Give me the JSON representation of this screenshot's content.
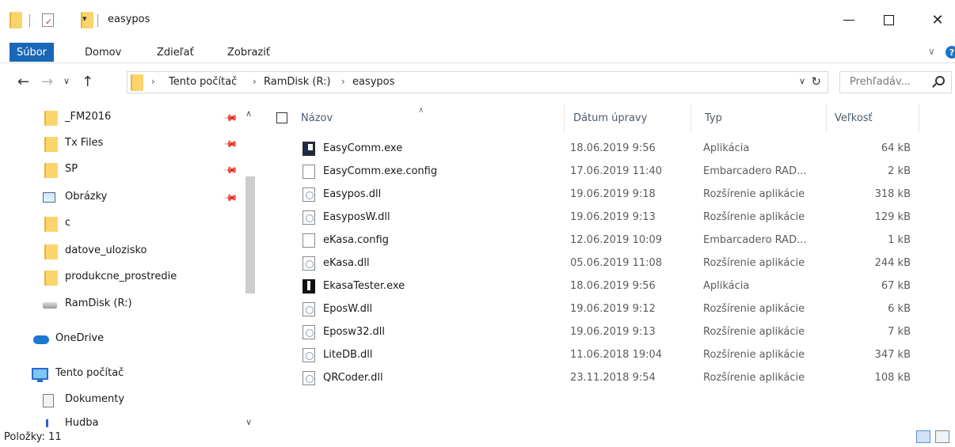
{
  "window": {
    "title": "easypos",
    "minimize_label": "—",
    "close_label": "✕"
  },
  "ribbon": {
    "tabs": [
      "Súbor",
      "Domov",
      "Zdieľať",
      "Zobraziť"
    ],
    "active_tab": "Súbor",
    "help_label": "?"
  },
  "address": {
    "breadcrumbs": [
      "Tento počítač",
      "RamDisk (R:)",
      "easypos"
    ]
  },
  "search": {
    "placeholder": "Prehľadáv..."
  },
  "nav": {
    "items": [
      {
        "label": "_FM2016",
        "icon": "folder-icon",
        "pinned": true
      },
      {
        "label": "Tx Files",
        "icon": "folder-icon",
        "pinned": true
      },
      {
        "label": "SP",
        "icon": "folder-icon",
        "pinned": true
      },
      {
        "label": "Obrázky",
        "icon": "pictures-icon",
        "pinned": true
      },
      {
        "label": "c",
        "icon": "folder-icon",
        "pinned": false
      },
      {
        "label": "datove_ulozisko",
        "icon": "folder-icon",
        "pinned": false
      },
      {
        "label": "produkcne_prostredie",
        "icon": "folder-icon",
        "pinned": false
      },
      {
        "label": "RamDisk (R:)",
        "icon": "drive-icon",
        "pinned": false
      },
      {
        "label": "OneDrive",
        "icon": "onedrive-icon",
        "pinned": false
      },
      {
        "label": "Tento počítač",
        "icon": "computer-icon",
        "pinned": false
      },
      {
        "label": "Dokumenty",
        "icon": "documents-icon",
        "pinned": false
      },
      {
        "label": "Hudba",
        "icon": "music-icon",
        "pinned": false
      }
    ]
  },
  "columns": {
    "name": "Názov",
    "date": "Dátum úpravy",
    "type": "Typ",
    "size": "Veľkosť"
  },
  "files": [
    {
      "name": "EasyComm.exe",
      "date": "18.06.2019 9:56",
      "type": "Aplikácia",
      "size": "64 kB",
      "icon": "exe-icon"
    },
    {
      "name": "EasyComm.exe.config",
      "date": "17.06.2019 11:40",
      "type": "Embarcadero RAD...",
      "size": "2 kB",
      "icon": "config-file-icon"
    },
    {
      "name": "Easypos.dll",
      "date": "19.06.2019 9:18",
      "type": "Rozšírenie aplikácie",
      "size": "318 kB",
      "icon": "dll-icon"
    },
    {
      "name": "EasyposW.dll",
      "date": "19.06.2019 9:13",
      "type": "Rozšírenie aplikácie",
      "size": "129 kB",
      "icon": "dll-icon"
    },
    {
      "name": "eKasa.config",
      "date": "12.06.2019 10:09",
      "type": "Embarcadero RAD...",
      "size": "1 kB",
      "icon": "config-file-icon"
    },
    {
      "name": "eKasa.dll",
      "date": "05.06.2019 11:08",
      "type": "Rozšírenie aplikácie",
      "size": "244 kB",
      "icon": "dll-icon"
    },
    {
      "name": "EkasaTester.exe",
      "date": "18.06.2019 9:56",
      "type": "Aplikácia",
      "size": "67 kB",
      "icon": "exe-icon"
    },
    {
      "name": "EposW.dll",
      "date": "19.06.2019 9:12",
      "type": "Rozšírenie aplikácie",
      "size": "6 kB",
      "icon": "dll-icon"
    },
    {
      "name": "Eposw32.dll",
      "date": "19.06.2019 9:13",
      "type": "Rozšírenie aplikácie",
      "size": "7 kB",
      "icon": "dll-icon"
    },
    {
      "name": "LiteDB.dll",
      "date": "11.06.2018 19:04",
      "type": "Rozšírenie aplikácie",
      "size": "347 kB",
      "icon": "dll-icon"
    },
    {
      "name": "QRCoder.dll",
      "date": "23.11.2018 9:54",
      "type": "Rozšírenie aplikácie",
      "size": "108 kB",
      "icon": "dll-icon"
    }
  ],
  "status": {
    "items_text": "Položky: 11"
  },
  "colors": {
    "file_tab": "#1968b8",
    "folder": "#fbd46b",
    "header_text": "#4a5b6e"
  }
}
